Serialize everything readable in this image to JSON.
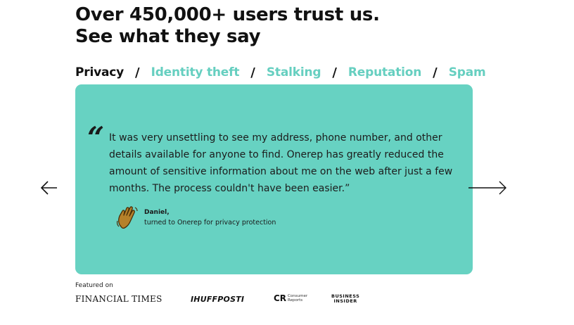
{
  "headline": {
    "line1": "Over 450,000+ users trust us.",
    "line2": "See what they say"
  },
  "tabs": [
    {
      "label": "Privacy",
      "active": true
    },
    {
      "label": "Identity theft",
      "active": false
    },
    {
      "label": "Stalking",
      "active": false
    },
    {
      "label": "Reputation",
      "active": false
    },
    {
      "label": "Spam",
      "active": false
    }
  ],
  "tab_separator": "/",
  "testimonial": {
    "quote_mark": "“",
    "text": "It was very unsettling to see my address, phone number, and other details available for anyone to find. Onerep has greatly reduced the amount of sensitive information about me on the web after just a few months. The process couldn't have been easier.”",
    "author_name": "Daniel,",
    "author_subtitle": "turned to Onerep for privacy protection",
    "author_icon": "waving-hand-icon"
  },
  "navigation": {
    "prev_icon": "arrow-left-icon",
    "next_icon": "arrow-right-icon"
  },
  "featured": {
    "label": "Featured on",
    "logos": {
      "ft": "FINANCIAL TIMES",
      "huff": "IHUFFPOSTI",
      "cr_mark": "CR",
      "cr_line1": "Consumer",
      "cr_line2": "Reports",
      "bi_line1": "BUSINESS",
      "bi_line2": "INSIDER"
    }
  },
  "colors": {
    "accent": "#67d2c2",
    "tab_inactive": "#66cfc0",
    "text": "#111111"
  }
}
